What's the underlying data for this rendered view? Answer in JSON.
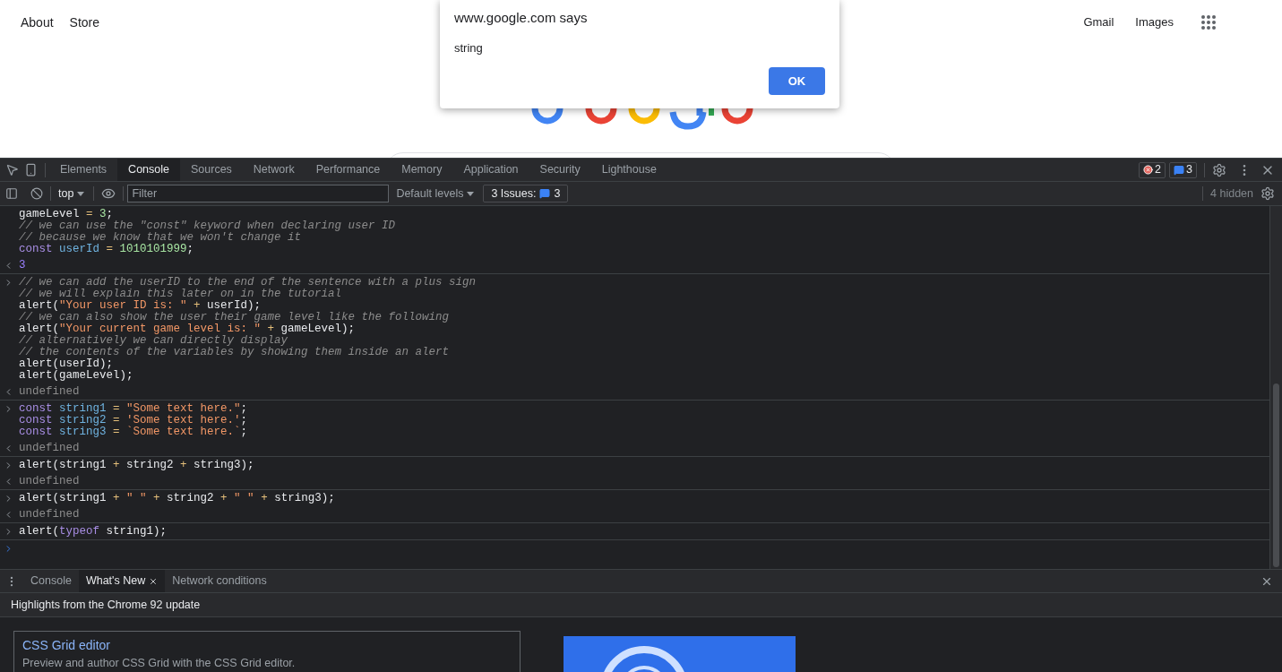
{
  "page": {
    "nav_left": [
      "About",
      "Store"
    ],
    "nav_right": [
      "Gmail",
      "Images"
    ]
  },
  "dialog": {
    "title": "www.google.com says",
    "message": "string",
    "button": "OK"
  },
  "devtools": {
    "tabs": [
      {
        "label": "Elements",
        "selected": false
      },
      {
        "label": "Console",
        "selected": true
      },
      {
        "label": "Sources",
        "selected": false
      },
      {
        "label": "Network",
        "selected": false
      },
      {
        "label": "Performance",
        "selected": false
      },
      {
        "label": "Memory",
        "selected": false
      },
      {
        "label": "Application",
        "selected": false
      },
      {
        "label": "Security",
        "selected": false
      },
      {
        "label": "Lighthouse",
        "selected": false
      }
    ],
    "error_count": "2",
    "message_count": "3",
    "toolbar": {
      "context": "top",
      "filter_placeholder": "Filter",
      "levels": "Default levels",
      "issues_label": "3 Issues:",
      "issues_count": "3",
      "hidden": "4 hidden"
    },
    "console": [
      {
        "kind": "input",
        "prompt": false,
        "lines": [
          [
            {
              "kind": "plain",
              "t": "gameLevel "
            },
            {
              "kind": "op",
              "t": "= "
            },
            {
              "kind": "num",
              "t": "3"
            },
            {
              "kind": "plain",
              "t": ";"
            }
          ],
          [
            {
              "kind": "comment",
              "t": "// we can use the \"const\" keyword when declaring user ID"
            }
          ],
          [
            {
              "kind": "comment",
              "t": "// because we know that we won't change it"
            }
          ],
          [
            {
              "kind": "kw",
              "t": "const "
            },
            {
              "kind": "var",
              "t": "userId "
            },
            {
              "kind": "op",
              "t": "= "
            },
            {
              "kind": "num",
              "t": "1010101999"
            },
            {
              "kind": "plain",
              "t": ";"
            }
          ]
        ]
      },
      {
        "kind": "output",
        "lines": [
          [
            {
              "kind": "result",
              "t": "3"
            }
          ]
        ]
      },
      {
        "kind": "input",
        "prompt": true,
        "lines": [
          [
            {
              "kind": "comment",
              "t": "// we can add the userID to the end of the sentence with a plus sign"
            }
          ],
          [
            {
              "kind": "comment",
              "t": "// we will explain this later on in the tutorial"
            }
          ],
          [
            {
              "kind": "plain",
              "t": "alert("
            },
            {
              "kind": "str",
              "t": "\"Your user ID is: \" "
            },
            {
              "kind": "op",
              "t": "+"
            },
            {
              "kind": "plain",
              "t": " userId);"
            }
          ],
          [
            {
              "kind": "comment",
              "t": "// we can also show the user their game level like the following"
            }
          ],
          [
            {
              "kind": "plain",
              "t": "alert("
            },
            {
              "kind": "str",
              "t": "\"Your current game level is: \" "
            },
            {
              "kind": "op",
              "t": "+"
            },
            {
              "kind": "plain",
              "t": " gameLevel);"
            }
          ],
          [
            {
              "kind": "comment",
              "t": "// alternatively we can directly display"
            }
          ],
          [
            {
              "kind": "comment",
              "t": "// the contents of the variables by showing them inside an alert"
            }
          ],
          [
            {
              "kind": "plain",
              "t": "alert(userId);"
            }
          ],
          [
            {
              "kind": "plain",
              "t": "alert(gameLevel);"
            }
          ]
        ]
      },
      {
        "kind": "output",
        "lines": [
          [
            {
              "kind": "undef",
              "t": "undefined"
            }
          ]
        ]
      },
      {
        "kind": "input",
        "prompt": true,
        "lines": [
          [
            {
              "kind": "kw",
              "t": "const "
            },
            {
              "kind": "var",
              "t": "string1 "
            },
            {
              "kind": "op",
              "t": "= "
            },
            {
              "kind": "str",
              "t": "\"Some text here.\""
            },
            {
              "kind": "plain",
              "t": ";"
            }
          ],
          [
            {
              "kind": "kw",
              "t": "const "
            },
            {
              "kind": "var",
              "t": "string2 "
            },
            {
              "kind": "op",
              "t": "= "
            },
            {
              "kind": "str",
              "t": "'Some text here.'"
            },
            {
              "kind": "plain",
              "t": ";"
            }
          ],
          [
            {
              "kind": "kw",
              "t": "const "
            },
            {
              "kind": "var",
              "t": "string3 "
            },
            {
              "kind": "op",
              "t": "= "
            },
            {
              "kind": "str",
              "t": "`Some text here.`"
            },
            {
              "kind": "plain",
              "t": ";"
            }
          ]
        ]
      },
      {
        "kind": "output",
        "lines": [
          [
            {
              "kind": "undef",
              "t": "undefined"
            }
          ]
        ]
      },
      {
        "kind": "input",
        "prompt": true,
        "lines": [
          [
            {
              "kind": "plain",
              "t": "alert(string1 "
            },
            {
              "kind": "op",
              "t": "+"
            },
            {
              "kind": "plain",
              "t": " string2 "
            },
            {
              "kind": "op",
              "t": "+"
            },
            {
              "kind": "plain",
              "t": " string3);"
            }
          ]
        ]
      },
      {
        "kind": "output",
        "lines": [
          [
            {
              "kind": "undef",
              "t": "undefined"
            }
          ]
        ]
      },
      {
        "kind": "input",
        "prompt": true,
        "lines": [
          [
            {
              "kind": "plain",
              "t": "alert(string1 "
            },
            {
              "kind": "op",
              "t": "+ "
            },
            {
              "kind": "str",
              "t": "\" \" "
            },
            {
              "kind": "op",
              "t": "+"
            },
            {
              "kind": "plain",
              "t": " string2 "
            },
            {
              "kind": "op",
              "t": "+ "
            },
            {
              "kind": "str",
              "t": "\" \" "
            },
            {
              "kind": "op",
              "t": "+"
            },
            {
              "kind": "plain",
              "t": " string3);"
            }
          ]
        ]
      },
      {
        "kind": "output",
        "lines": [
          [
            {
              "kind": "undef",
              "t": "undefined"
            }
          ]
        ]
      },
      {
        "kind": "input",
        "prompt": true,
        "lines": [
          [
            {
              "kind": "plain",
              "t": "alert("
            },
            {
              "kind": "kw",
              "t": "typeof"
            },
            {
              "kind": "plain",
              "t": " string1);"
            }
          ]
        ]
      },
      {
        "kind": "empty_prompt"
      }
    ],
    "drawer": {
      "tabs": [
        {
          "label": "Console",
          "selected": false,
          "closable": false
        },
        {
          "label": "What's New",
          "selected": true,
          "closable": true
        },
        {
          "label": "Network conditions",
          "selected": false,
          "closable": false
        }
      ],
      "heading": "Highlights from the Chrome 92 update",
      "card": {
        "title": "CSS Grid editor",
        "description": "Preview and author CSS Grid with the CSS Grid editor."
      }
    }
  }
}
